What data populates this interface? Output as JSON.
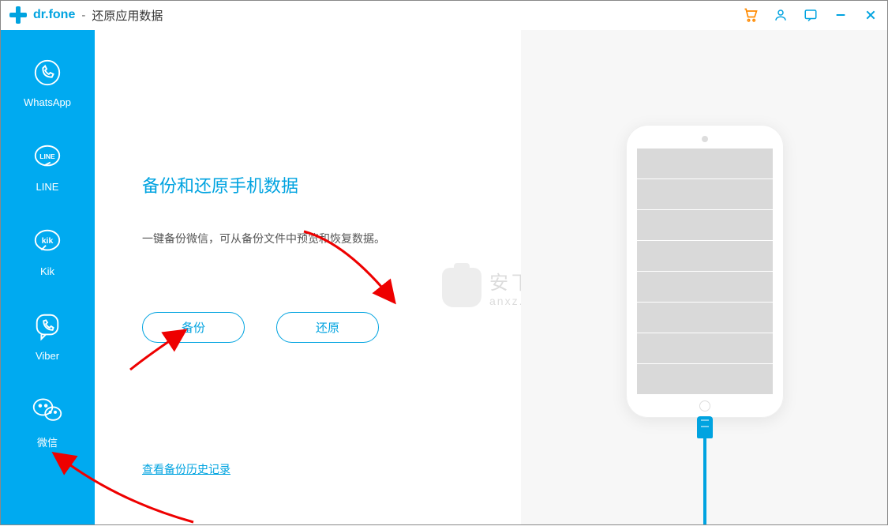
{
  "header": {
    "brand": "dr.fone",
    "separator": "-",
    "title": "还原应用数据"
  },
  "sidebar": {
    "items": [
      {
        "label": "WhatsApp"
      },
      {
        "label": "LINE"
      },
      {
        "label": "Kik"
      },
      {
        "label": "Viber"
      },
      {
        "label": "微信"
      }
    ]
  },
  "content": {
    "heading": "备份和还原手机数据",
    "description": "一键备份微信，可从备份文件中预览和恢复数据。",
    "backup_label": "备份",
    "restore_label": "还原",
    "history_link": "查看备份历史记录"
  },
  "watermark": {
    "zh": "安下载",
    "en": "anxz.com"
  }
}
